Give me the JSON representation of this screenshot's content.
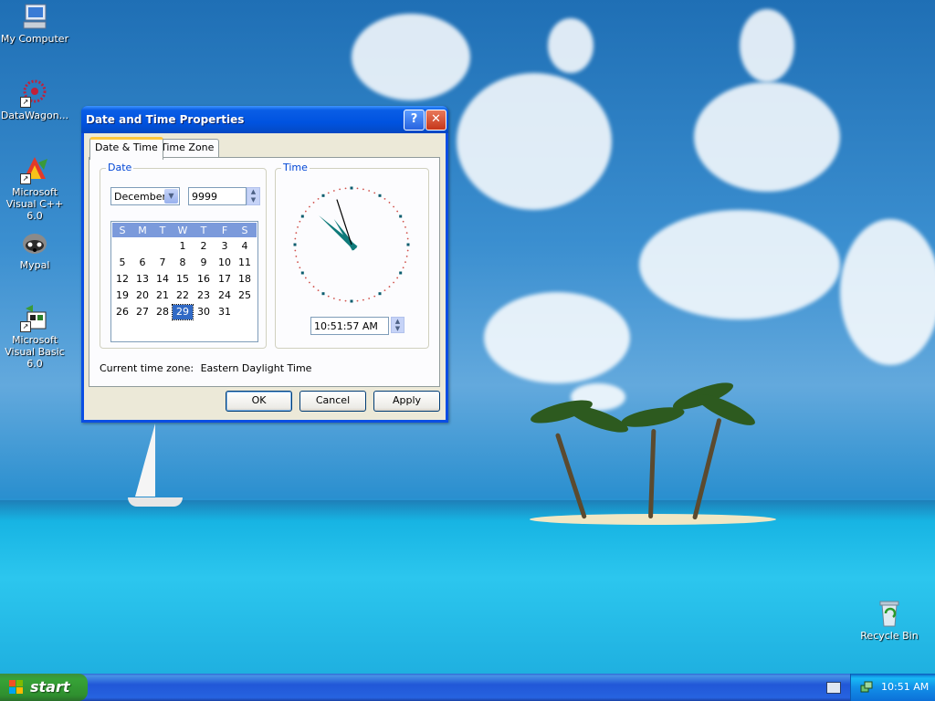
{
  "desktop": {
    "icons": [
      {
        "label": "My Computer",
        "icon": "computer-icon"
      },
      {
        "label": "DataWagon...",
        "icon": "datawagon-icon"
      },
      {
        "label": "Microsoft Visual C++ 6.0",
        "icon": "visual-cpp-icon"
      },
      {
        "label": "Mypal",
        "icon": "mypal-icon"
      },
      {
        "label": "Microsoft Visual Basic 6.0",
        "icon": "visual-basic-icon"
      },
      {
        "label": "Recycle Bin",
        "icon": "recycle-bin-icon"
      }
    ]
  },
  "dialog": {
    "title": "Date and Time Properties",
    "help_glyph": "?",
    "close_glyph": "✕",
    "tabs": [
      {
        "label": "Date & Time",
        "active": true
      },
      {
        "label": "Time Zone",
        "active": false
      }
    ],
    "date_group": {
      "label": "Date",
      "month": "December",
      "year": "9999",
      "weekday_headers": [
        "S",
        "M",
        "T",
        "W",
        "T",
        "F",
        "S"
      ],
      "weeks": [
        [
          "",
          "",
          "",
          "",
          "1",
          "2",
          "3",
          "4"
        ],
        [
          "5",
          "6",
          "7",
          "8",
          "9",
          "10",
          "11"
        ],
        [
          "12",
          "13",
          "14",
          "15",
          "16",
          "17",
          "18"
        ],
        [
          "19",
          "20",
          "21",
          "22",
          "23",
          "24",
          "25"
        ],
        [
          "26",
          "27",
          "28",
          "29",
          "30",
          "31",
          ""
        ]
      ],
      "selected_day": "29"
    },
    "time_group": {
      "label": "Time",
      "time_value": "10:51:57 AM",
      "clock": {
        "hour": 10,
        "minute": 51,
        "second": 57
      }
    },
    "timezone_label": "Current time zone:",
    "timezone_value": "Eastern Daylight Time",
    "buttons": {
      "ok": "OK",
      "cancel": "Cancel",
      "apply": "Apply"
    }
  },
  "taskbar": {
    "start_label": "start",
    "clock": "10:51 AM"
  },
  "colors": {
    "title_bar": "#0053e0",
    "group_label": "#0046d5",
    "calendar_header": "#7b9adb",
    "selection": "#316ac5",
    "clock_marks": "#0f7a7a"
  }
}
